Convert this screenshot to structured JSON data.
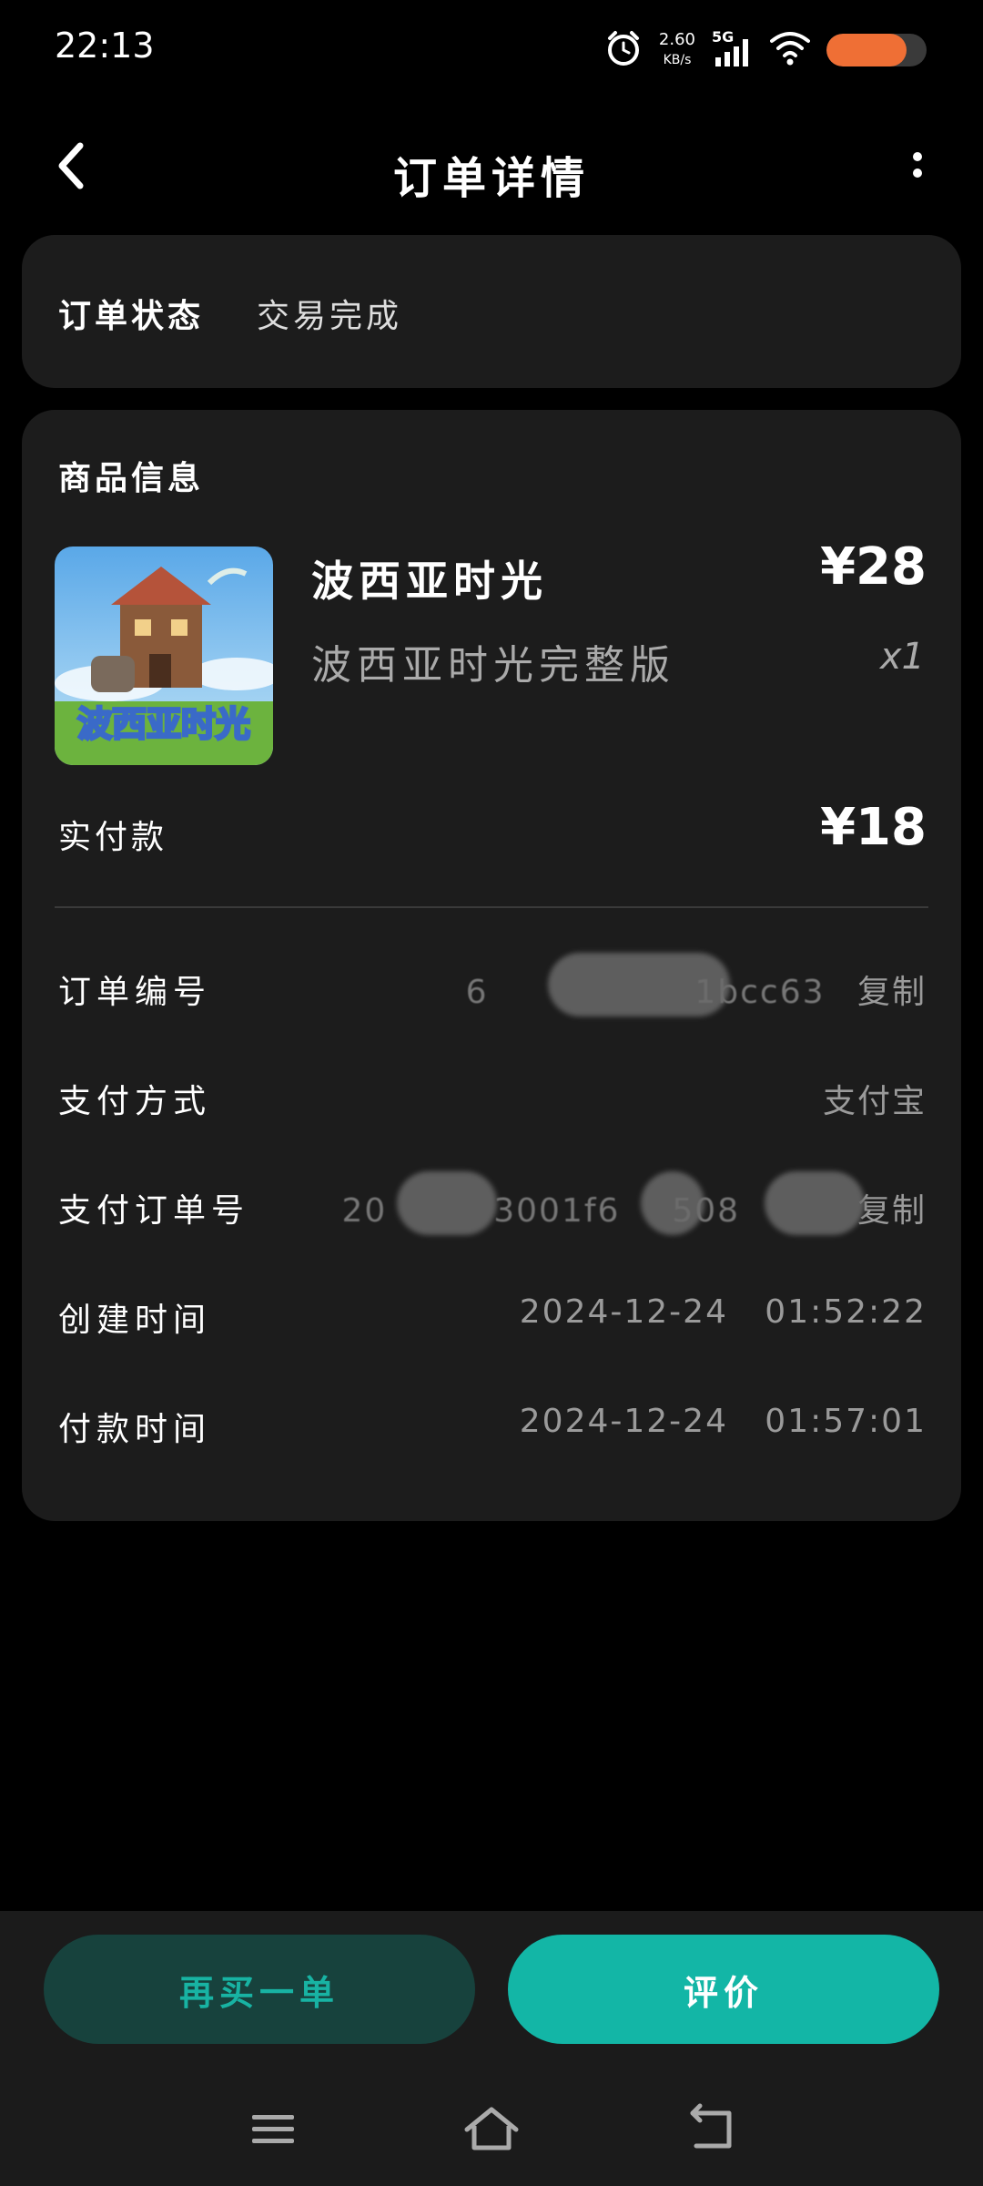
{
  "status_bar": {
    "time": "22:13",
    "net_speed_value": "2.60",
    "net_speed_unit": "KB/s",
    "network": "5G",
    "icons": [
      "alarm-icon",
      "signal-icon",
      "wifi-icon",
      "battery-icon"
    ],
    "battery_level": 0.8,
    "battery_color": "#ef6f35"
  },
  "header": {
    "title": "订单详情",
    "back_icon": "chevron-left-icon",
    "more_icon": "more-vertical-icon"
  },
  "order_status": {
    "label": "订单状态",
    "value": "交易完成"
  },
  "product_section": {
    "title": "商品信息",
    "product": {
      "name": "波西亚时光",
      "price": "¥28",
      "variant": "波西亚时光完整版",
      "quantity": "x1",
      "thumb_text": "波西亚时光"
    },
    "paid": {
      "label": "实付款",
      "value": "¥18"
    },
    "details": {
      "order_no": {
        "label": "订单编号",
        "value_prefix": "6",
        "value_suffix": "1bcc63",
        "copy": "复制"
      },
      "pay_method": {
        "label": "支付方式",
        "value": "支付宝"
      },
      "pay_order_no": {
        "label": "支付订单号",
        "value_prefix": "20",
        "value_middle": "3001f6",
        "value_suffix": "508",
        "copy": "复制"
      },
      "created_time": {
        "label": "创建时间",
        "value": "2024-12-24   01:52:22"
      },
      "paid_time": {
        "label": "付款时间",
        "value": "2024-12-24   01:57:01"
      }
    }
  },
  "actions": {
    "rebuy": "再买一单",
    "review": "评价"
  },
  "nav_bar": {
    "icons": [
      "menu-icon",
      "home-icon",
      "back-icon"
    ]
  },
  "colors": {
    "accent": "#13b6a6",
    "accent_dark": "#17423d",
    "card_bg": "#1c1c1c",
    "page_bg": "#000000"
  }
}
